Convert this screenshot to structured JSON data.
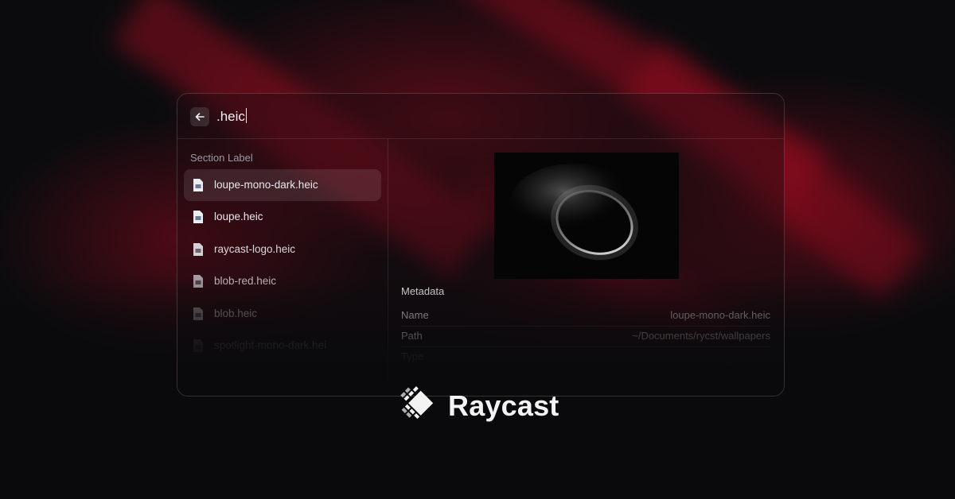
{
  "search": {
    "query": ".heic"
  },
  "list": {
    "section_label": "Section Label",
    "items": [
      {
        "label": "loupe-mono-dark.heic"
      },
      {
        "label": "loupe.heic"
      },
      {
        "label": "raycast-logo.heic"
      },
      {
        "label": "blob-red.heic"
      },
      {
        "label": "blob.heic"
      },
      {
        "label": "spotlight-mono-dark.hei"
      }
    ]
  },
  "detail": {
    "metadata_title": "Metadata",
    "rows": [
      {
        "key": "Name",
        "value": "loupe-mono-dark.heic"
      },
      {
        "key": "Path",
        "value": "~/Documents/rycst/wallpapers"
      },
      {
        "key": "Type",
        "value": ""
      }
    ]
  },
  "brand": {
    "name": "Raycast"
  },
  "icons": {
    "back": "arrow-left-icon",
    "file": "image-file-icon",
    "logo": "raycast-logo-icon"
  },
  "colors": {
    "accent_red": "#b5112b",
    "background": "#0a0a0c"
  }
}
